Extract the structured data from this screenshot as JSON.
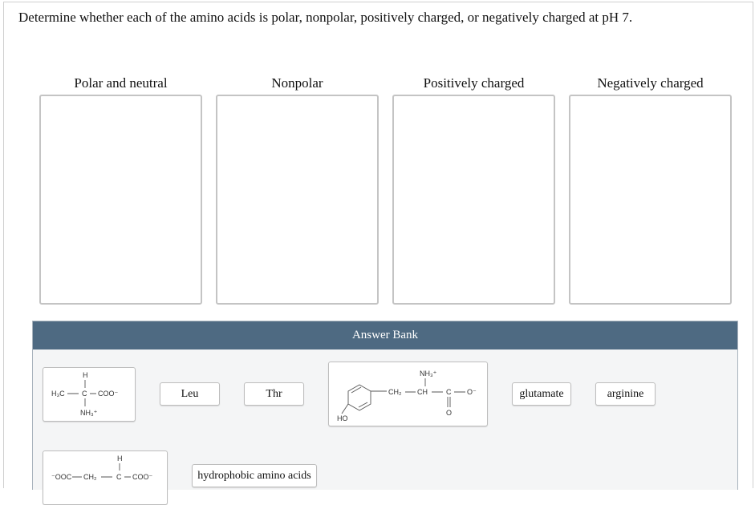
{
  "question": "Determine whether each of the amino acids is polar, nonpolar, positively charged, or negatively charged at pH 7.",
  "bins": [
    {
      "label": "Polar and neutral"
    },
    {
      "label": "Nonpolar"
    },
    {
      "label": "Positively charged"
    },
    {
      "label": "Negatively charged"
    }
  ],
  "answer_bank": {
    "title": "Answer Bank",
    "tiles": {
      "leu": "Leu",
      "thr": "Thr",
      "glutamate": "glutamate",
      "arginine": "arginine",
      "hydrophobic": "hydrophobic amino acids"
    },
    "alanine_structure": {
      "h": "H",
      "left": "H₃C",
      "c": "C",
      "right": "COO⁻",
      "bottom": "NH₃⁺"
    },
    "tyrosine_structure": {
      "nh3": "NH₃⁺",
      "ch2": "CH₂",
      "ch": "CH",
      "c": "C",
      "o_minus": "O⁻",
      "o": "O",
      "ho": "HO"
    },
    "aspartate_structure": {
      "h": "H",
      "chain_left": "⁻OOC",
      "ch2": "CH₂",
      "c": "C",
      "right": "COO⁻"
    }
  }
}
